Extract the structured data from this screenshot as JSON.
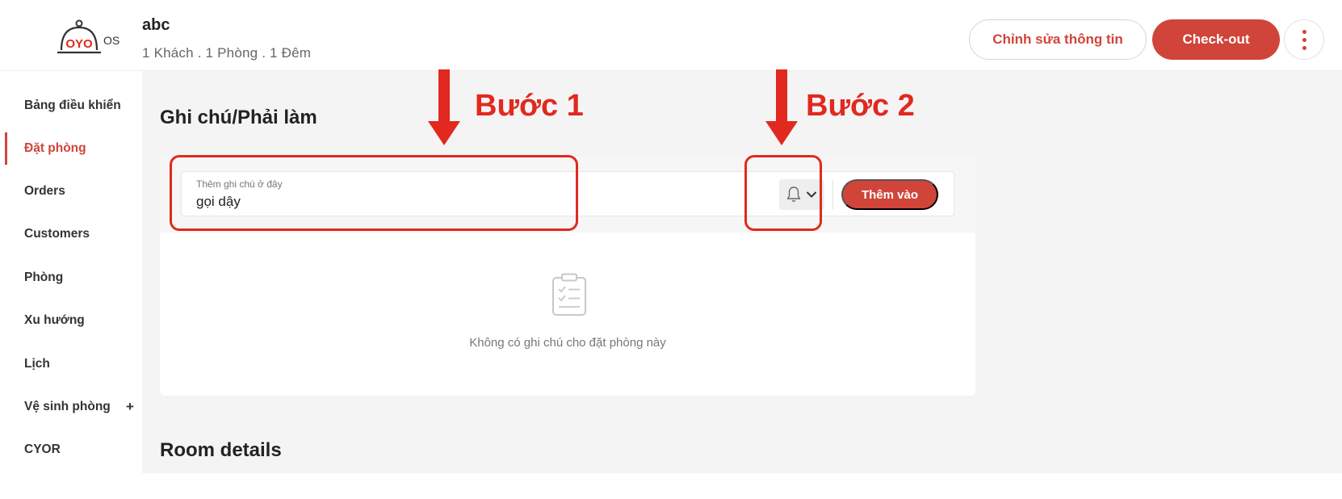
{
  "header": {
    "logo_text": "OYO OS",
    "booking_title": "abc",
    "booking_subtitle": "1 Khách . 1 Phòng . 1 Đêm",
    "edit_button": "Chỉnh sửa thông tin",
    "checkout_button": "Check-out",
    "more_icon": "more-vertical-icon"
  },
  "sidebar": {
    "items": [
      {
        "label": "Bảng điều khiển"
      },
      {
        "label": "Đặt phòng"
      },
      {
        "label": "Orders"
      },
      {
        "label": "Customers"
      },
      {
        "label": "Phòng"
      },
      {
        "label": "Xu hướng"
      },
      {
        "label": "Lịch"
      },
      {
        "label": "Vệ sinh phòng"
      },
      {
        "label": "CYOR"
      }
    ],
    "active_item": "Đặt phòng",
    "expand_symbol": "+"
  },
  "notes": {
    "title": "Ghi chú/Phải làm",
    "input_label": "Thêm ghi chú ở đây",
    "input_value": "gọi dậy",
    "reminder_icon": "bell-icon",
    "add_button": "Thêm vào",
    "empty_text": "Không có ghi chú cho đặt phòng này"
  },
  "room_details": {
    "title": "Room details"
  },
  "annotations": {
    "step1": "Bước 1",
    "step2": "Bước 2",
    "color": "#e1291f"
  },
  "colors": {
    "accent": "#d0443a",
    "background": "#f4f4f4"
  }
}
